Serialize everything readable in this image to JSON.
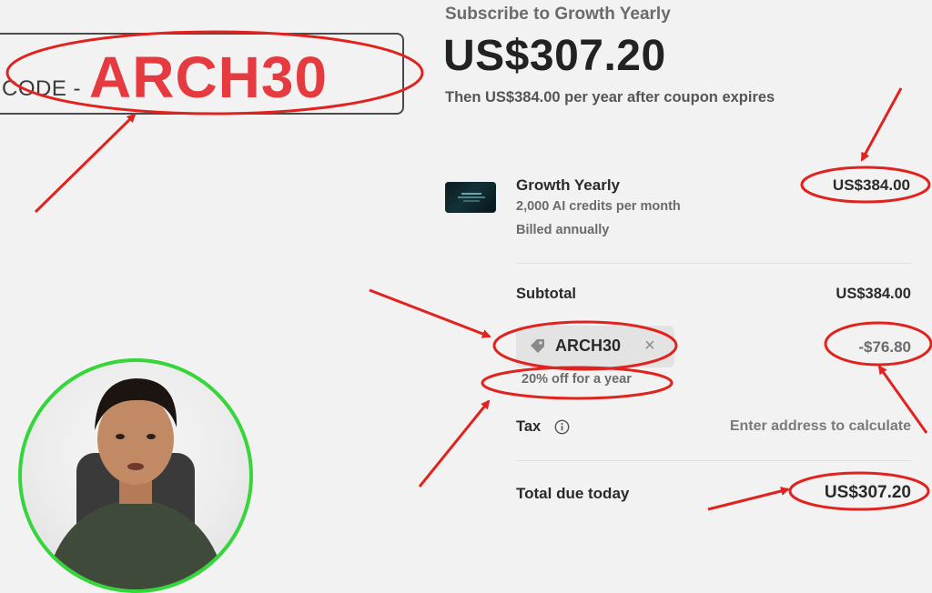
{
  "promo_banner": {
    "label": "CODE -",
    "code": "ARCH30"
  },
  "summary": {
    "title": "Subscribe to Growth Yearly",
    "price": "US$307.20",
    "then_text": "Then US$384.00 per year after coupon expires"
  },
  "line_item": {
    "name": "Growth Yearly",
    "credits": "2,000 AI credits per month",
    "billing": "Billed annually",
    "price": "US$384.00",
    "thumbnail_text": "Create Any Short Video, Fast"
  },
  "subtotal": {
    "label": "Subtotal",
    "value": "US$384.00"
  },
  "coupon": {
    "code": "ARCH30",
    "discount": "-$76.80",
    "note": "20% off for a year",
    "remove_icon": "×"
  },
  "tax": {
    "label": "Tax",
    "value": "Enter address to calculate"
  },
  "total": {
    "label": "Total due today",
    "value": "US$307.20"
  },
  "colors": {
    "annotation_red": "#e0231f",
    "webcam_ring": "#35d63a",
    "code_red": "#e53a3f"
  }
}
